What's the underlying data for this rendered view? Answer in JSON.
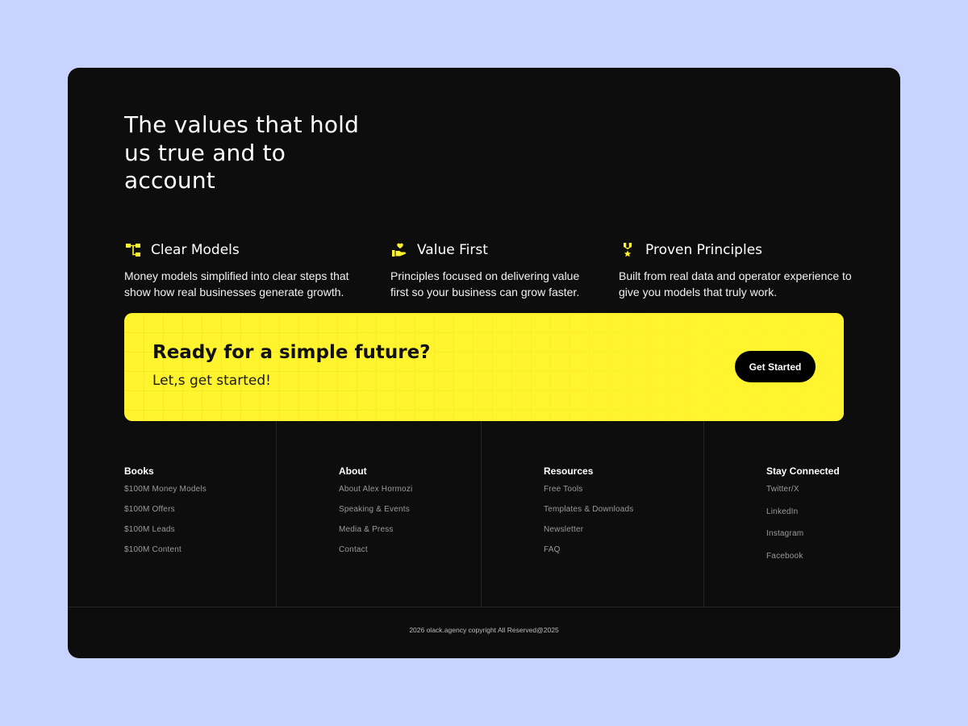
{
  "headline": "The values that hold us true and to account",
  "values": [
    {
      "icon": "flowchart-icon",
      "title": "Clear Models",
      "description": "Money models simplified into clear steps that show how real businesses generate growth."
    },
    {
      "icon": "hand-heart-icon",
      "title": "Value First",
      "description": "Principles focused on delivering value first so your business can grow faster."
    },
    {
      "icon": "medal-icon",
      "title": "Proven Principles",
      "description": "Built from real data and operator experience to give you models that truly work."
    }
  ],
  "cta": {
    "title": "Ready for a simple future?",
    "subtitle": "Let,s get started!",
    "button_label": "Get Started",
    "background_color": "#fff42e"
  },
  "footer": {
    "columns": [
      {
        "title": "Books",
        "links": [
          "$100M Money Models",
          "$100M Offers",
          "$100M Leads",
          "$100M Content"
        ]
      },
      {
        "title": "About",
        "links": [
          "About Alex Hormozi",
          "Speaking & Events",
          "Media & Press",
          "Contact"
        ]
      },
      {
        "title": "Resources",
        "links": [
          "Free Tools",
          "Templates & Downloads",
          "Newsletter",
          "FAQ"
        ]
      },
      {
        "title": "Stay Connected",
        "links": [
          "Twitter/X",
          "LinkedIn",
          "Instagram",
          "Facebook"
        ]
      }
    ],
    "copyright": "2026 olack.agency copyright All Reserved@2025"
  },
  "colors": {
    "page_background": "#c9d3ff",
    "card_background": "#0d0d0d",
    "accent_yellow": "#fff42e"
  }
}
